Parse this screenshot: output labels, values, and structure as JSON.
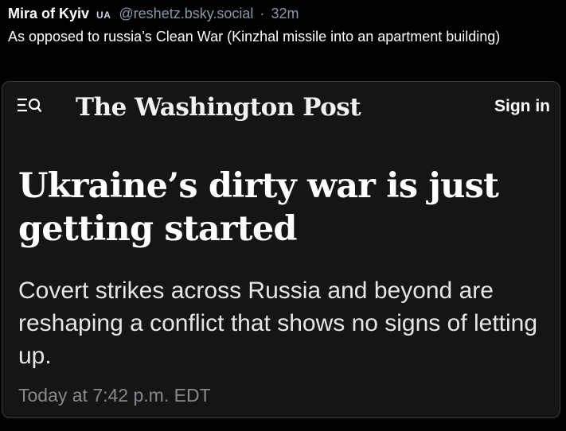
{
  "post": {
    "author_name": "Mira of Kyiv",
    "author_flag": "UA",
    "handle": "@reshetz.bsky.social",
    "separator": "·",
    "time": "32m",
    "text": "As opposed to russia’s Clean War (Kinzhal missile into an apartment building)"
  },
  "embed": {
    "menu_icon": "menu-search-icon",
    "masthead": "The Washington Post",
    "sign_in_label": "Sign in",
    "headline": "Ukraine’s dirty war is just getting started",
    "subhead": "Covert strikes across Russia and beyond are reshaping a conflict that shows no signs of letting up.",
    "timestamp": "Today at 7:42 p.m. EDT"
  },
  "colors": {
    "background": "#000000",
    "card_background": "#151517",
    "muted_text": "#8b98a5"
  }
}
